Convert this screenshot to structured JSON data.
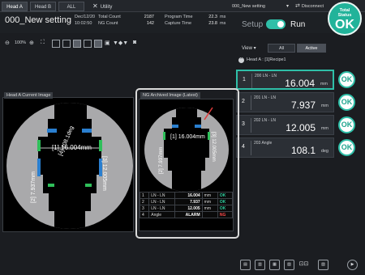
{
  "tabs": [
    {
      "label": "Head A",
      "active": true
    },
    {
      "label": "Head B",
      "active": false
    },
    {
      "label": "ALL",
      "active": false
    }
  ],
  "utility_label": "Utility",
  "setting_select": "000_New setting",
  "disconnect_label": "Disconnect",
  "setting_name": "000_New setting",
  "stats": {
    "date": "Dec/12/20",
    "time": "10:02:50",
    "total_count_label": "Total Count",
    "total_count": "2187",
    "ng_count_label": "NG Count",
    "ng_count": "142",
    "program_time_label": "Program Time",
    "program_time": "22.3",
    "program_time_unit": "ms",
    "capture_time_label": "Capture Time",
    "capture_time": "23.8",
    "capture_time_unit": "ms"
  },
  "mode": {
    "setup_label": "Setup",
    "run_label": "Run",
    "running": true
  },
  "total_status": {
    "title_line1": "Total",
    "title_line2": "Status",
    "result": "OK"
  },
  "toolbar": {
    "zoom": "100%"
  },
  "view": {
    "label": "View",
    "options": [
      "All",
      "Active"
    ],
    "selected": "Active"
  },
  "head_label": "Head A : [1]Recipe1",
  "measurements": [
    {
      "index": "1",
      "name": "200 LN - LN",
      "value": "16.004",
      "unit": "mm",
      "status": "OK",
      "selected": true
    },
    {
      "index": "2",
      "name": "201 LN - LN",
      "value": "7.937",
      "unit": "mm",
      "status": "OK",
      "selected": false
    },
    {
      "index": "3",
      "name": "202 LN - LN",
      "value": "12.005",
      "unit": "mm",
      "status": "OK",
      "selected": false
    },
    {
      "index": "4",
      "name": "203 Angle",
      "value": "108.1",
      "unit": "deg",
      "status": "OK",
      "selected": false
    }
  ],
  "panel_a": {
    "title": "Head A Current Image",
    "labels": {
      "m1": "[1] 16.004mm",
      "m2": "[2] 7.937mm",
      "m3": "[3] 12.005mm",
      "m4": "[4] 108.1deg"
    }
  },
  "panel_b": {
    "title": "NG Archived Image (Latest)",
    "labels": {
      "m1": "[1] 16.004mm",
      "m2": "[2] 7.937mm",
      "m3": "[3] 12.005mm"
    },
    "table": [
      {
        "index": "1",
        "name": "LN - LN",
        "value": "16.004",
        "unit": "mm",
        "status": "OK"
      },
      {
        "index": "2",
        "name": "LN - LN",
        "value": "7.937",
        "unit": "mm",
        "status": "OK"
      },
      {
        "index": "3",
        "name": "LN - LN",
        "value": "12.005",
        "unit": "mm",
        "status": "OK"
      },
      {
        "index": "4",
        "name": "Angle",
        "value": "ALARM",
        "unit": "",
        "status": "NG"
      }
    ]
  },
  "bottom_icons": [
    "image-icon",
    "chart-icon",
    "histogram-icon",
    "trend-icon",
    "list-icon",
    "report-icon",
    "play-icon"
  ],
  "colors": {
    "accent": "#2fbfa8",
    "ok": "#2fd0a0",
    "ng": "#ff4a4a",
    "background": "#1b1d21"
  }
}
